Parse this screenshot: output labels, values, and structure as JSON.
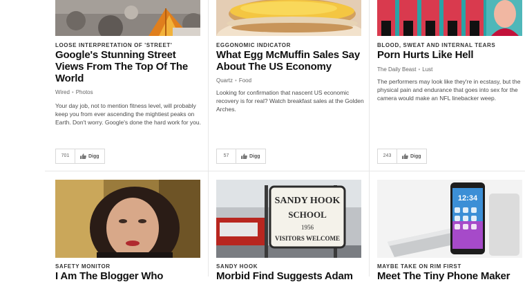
{
  "row1": [
    {
      "kicker": "LOOSE INTERPRETATION OF 'STREET'",
      "headline": "Google's Stunning Street Views From The Top Of The World",
      "source": "Wired",
      "category": "Photos",
      "description": "Your day job, not to mention fitness level, will probably keep you from ever ascending the mightiest peaks on Earth. Don't worry. Google's done the hard work for you.",
      "digg_count": "701",
      "digg_label": "Digg"
    },
    {
      "kicker": "EGGONOMIC INDICATOR",
      "headline": "What Egg McMuffin Sales Say About The US Economy",
      "source": "Quartz",
      "category": "Food",
      "description": "Looking for confirmation that nascent US economic recovery is for real? Watch breakfast sales at the Golden Arches.",
      "digg_count": "57",
      "digg_label": "Digg"
    },
    {
      "kicker": "BLOOD, SWEAT AND INTERNAL TEARS",
      "headline": "Porn Hurts Like Hell",
      "source": "The Daily Beast",
      "category": "Lust",
      "description": "The performers may look like they're in ecstasy, but the physical pain and endurance that goes into sex for the camera would make an NFL linebacker weep.",
      "digg_count": "243",
      "digg_label": "Digg"
    }
  ],
  "row2": [
    {
      "kicker": "SAFETY MONITOR",
      "headline": "I Am The Blogger Who"
    },
    {
      "kicker": "SANDY HOOK",
      "headline": "Morbid Find Suggests Adam",
      "sign_text": [
        "SANDY HOOK",
        "SCHOOL",
        "1956",
        "VISITORS WELCOME"
      ]
    },
    {
      "kicker": "MAYBE TAKE ON RIM FIRST",
      "headline": "Meet The Tiny Phone Maker",
      "phone_time": "12:34"
    }
  ]
}
